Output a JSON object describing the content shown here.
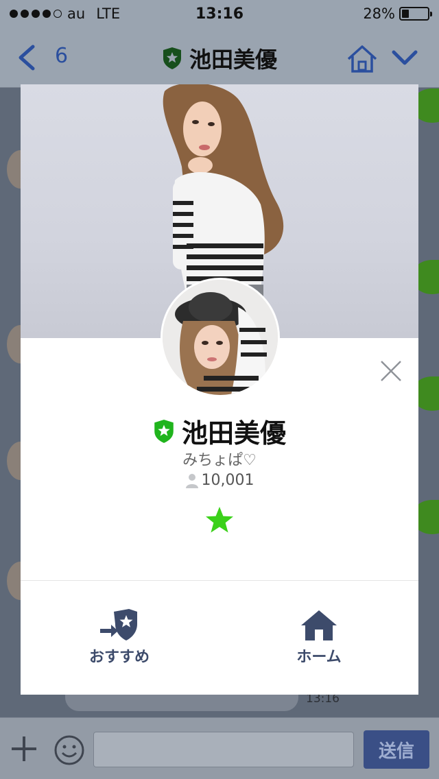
{
  "status_bar": {
    "carrier": "au",
    "network": "LTE",
    "time": "13:16",
    "battery_text": "28%",
    "battery_level": 0.28,
    "signal_bars": 4
  },
  "nav": {
    "unread_count": "6",
    "title": "池田美優"
  },
  "chat": {
    "last_time": "13:16"
  },
  "input_bar": {
    "send_label": "送信"
  },
  "profile": {
    "name": "池田美優",
    "status_message": "みちょぱ♡",
    "friend_count": "10,001",
    "official_badge_color": "#20b41d",
    "favorite_color": "#3bd11a"
  },
  "actions": {
    "recommend_label": "おすすめ",
    "home_label": "ホーム"
  },
  "colors": {
    "accent": "#2b4f9e",
    "action_icon": "#3d4b6b"
  }
}
